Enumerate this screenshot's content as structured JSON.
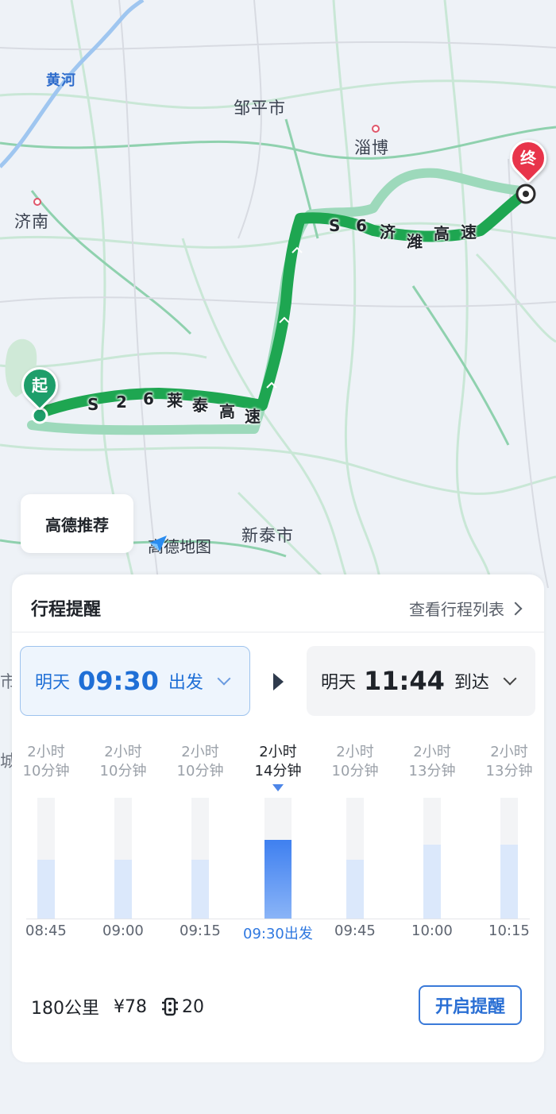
{
  "map": {
    "cities": {
      "jinan": "济南",
      "zouping": "邹平市",
      "zibo": "淄博",
      "xintai": "新泰市",
      "edge_left_1": "市",
      "edge_left_2": "城市"
    },
    "river": "黄河",
    "roads": {
      "s26": [
        "S",
        "2",
        "6",
        "莱",
        "泰",
        "高",
        "速"
      ],
      "s6": [
        "S",
        "6",
        "济",
        "潍",
        "高",
        "速"
      ]
    },
    "start_pin": "起",
    "end_pin": "终",
    "recommendation": "高德推荐",
    "logo": "高德地图",
    "colors": {
      "route_active": "#1ea651",
      "route_alt": "#8fd6b3",
      "start_pin": "#1e9e6a",
      "end_pin": "#e8344a"
    }
  },
  "sheet": {
    "title": "行程提醒",
    "list_link": "查看行程列表",
    "depart": {
      "day": "明天",
      "time": "09:30",
      "action": "出发"
    },
    "arrive": {
      "day": "明天",
      "time": "11:44",
      "action": "到达"
    },
    "options": [
      {
        "dur1": "2小时",
        "dur2": "10分钟",
        "time": "08:45",
        "level": 0.49,
        "selected": false
      },
      {
        "dur1": "2小时",
        "dur2": "10分钟",
        "time": "09:00",
        "level": 0.49,
        "selected": false
      },
      {
        "dur1": "2小时",
        "dur2": "10分钟",
        "time": "09:15",
        "level": 0.49,
        "selected": false
      },
      {
        "dur1": "2小时",
        "dur2": "14分钟",
        "time": "09:30出发",
        "level": 0.65,
        "selected": true
      },
      {
        "dur1": "2小时",
        "dur2": "10分钟",
        "time": "09:45",
        "level": 0.49,
        "selected": false
      },
      {
        "dur1": "2小时",
        "dur2": "13分钟",
        "time": "10:00",
        "level": 0.61,
        "selected": false
      },
      {
        "dur1": "2小时",
        "dur2": "13分钟",
        "time": "10:15",
        "level": 0.61,
        "selected": false
      }
    ],
    "stats": {
      "distance": "180公里",
      "toll": "¥78",
      "lights": "20"
    },
    "remind_button": "开启提醒"
  }
}
